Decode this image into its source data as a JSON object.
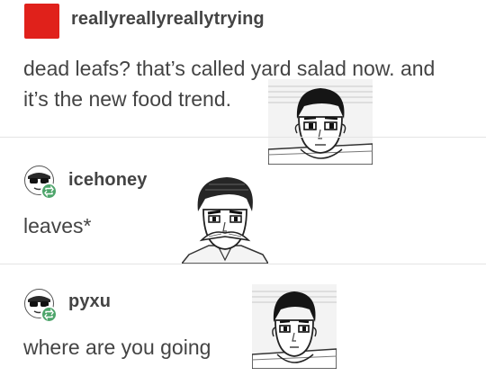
{
  "posts": [
    {
      "username": "reallyreallyreallytrying",
      "lines": [
        "dead leafs? that’s called yard salad now. and",
        "it’s the new food trend."
      ],
      "avatar_color": "#e0211b",
      "image_icon": "manga-boy-face-icon"
    },
    {
      "username": "icehoney",
      "lines": [
        "leaves*"
      ],
      "avatar_icon": "sunglasses-avatar-icon",
      "badge_icon": "reblog-icon",
      "image_icon": "manga-mustache-man-icon"
    },
    {
      "username": "pyxu",
      "lines": [
        "where are you going"
      ],
      "avatar_icon": "sunglasses-avatar-icon",
      "badge_icon": "reblog-icon",
      "image_icon": "manga-boy-face-icon"
    }
  ],
  "colors": {
    "text": "#444444",
    "divider": "#e4e4e4",
    "reblog_badge": "#4ea56b"
  }
}
